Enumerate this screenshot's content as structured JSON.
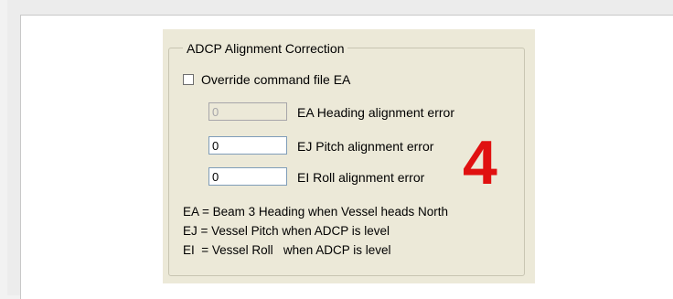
{
  "group": {
    "title": "ADCP Alignment Correction",
    "override_label": "Override command file EA",
    "override_checked": false
  },
  "fields": {
    "ea": {
      "value": "0",
      "label": "EA  Heading alignment error",
      "enabled": false
    },
    "ej": {
      "value": "0",
      "label": "EJ  Pitch alignment error",
      "enabled": true
    },
    "ei": {
      "value": "0",
      "label": "EI  Roll alignment error",
      "enabled": true
    }
  },
  "annotation": {
    "text": "4",
    "color": "#e01010"
  },
  "notes": {
    "line1": "EA = Beam 3 Heading when Vessel heads North",
    "line2": "EJ = Vessel Pitch when ADCP is level",
    "line3": "EI  = Vessel Roll   when ADCP is level"
  },
  "colors": {
    "dialog_bg": "#ece9d8",
    "textbox_border": "#7f9db9"
  }
}
